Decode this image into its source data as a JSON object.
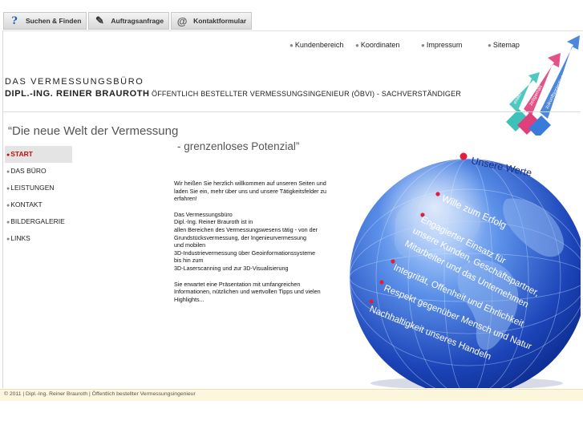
{
  "toolbar": {
    "tabs": [
      {
        "label": "Suchen & Finden",
        "icon": "question-icon"
      },
      {
        "label": "Auftragsanfrage",
        "icon": "pen-icon"
      },
      {
        "label": "Kontaktformular",
        "icon": "mail-icon"
      }
    ]
  },
  "topnav": [
    {
      "label": "Kundenbereich"
    },
    {
      "label": "Koordinaten"
    },
    {
      "label": "Impressum"
    },
    {
      "label": "Sitemap"
    }
  ],
  "header": {
    "line1": "DAS VERMESSUNGSBÜRO",
    "line2": "DIPL.-ING. REINER BRAUROTH",
    "line3": "ÖFFENTLICH BESTELLTER VERMESSUNGSINGENIEUR (ÖBVI)  -  SACHVERSTÄNDIGER",
    "arrow_labels": [
      "exakt",
      "zeitgemäß",
      "zukunftsorientiert"
    ]
  },
  "slogan": {
    "line1": "“Die neue Welt der Vermessung",
    "line2": "- grenzenloses Potenzial”"
  },
  "sidebar": {
    "items": [
      {
        "label": "START",
        "active": true
      },
      {
        "label": "DAS BÜRO",
        "active": false
      },
      {
        "label": "LEISTUNGEN",
        "active": false
      },
      {
        "label": "KONTAKT",
        "active": false
      },
      {
        "label": "BILDERGALERIE",
        "active": false
      },
      {
        "label": "LINKS",
        "active": false
      }
    ]
  },
  "content": {
    "para1": "Wir heißen Sie herzlich willkommen auf unseren Seiten und laden Sie ein, mehr über uns und unsere Tätigkeitsfelder zu erfahren!",
    "para2_lines": [
      "Das Vermessungsbüro",
      "Dipl.-Ing. Reiner Brauroth ist in",
      "allen Bereichen des Vermessungswesens tätig - von der",
      "Grundstücksvermessung, der Ingenieurvermessung",
      "und mobilen",
      "3D-Industrievermessung über Geoinformationssysteme",
      "bis hin zum",
      "3D-Laserscanning und zur 3D-Visualisierung"
    ],
    "para3": "Sie erwartet eine Präsentation mit umfangreichen Informationen, nützlichen und wertvollen Tipps und vielen Highlights..."
  },
  "globe": {
    "title": "Unsere Werte",
    "values": [
      "Wille zum Erfolg",
      "Engagierter Einsatz für",
      "unsere Kunden, Geschäftspartner,",
      "Mitarbeiter und das Unternehmen",
      "Integrität, Offenheit und Ehrlichkeit",
      "Respekt gegenüber Mensch und Natur",
      "Nachhaltigkeit unseres Handeln"
    ]
  },
  "footer": {
    "text": "© 2011 | Dipl.-Ing. Reiner Brauroth | Öffentlich bestellter Vermessungsingenieur"
  },
  "colors": {
    "active": "#c01010",
    "globe_dark": "#0b2a8a",
    "globe_light": "#7fb0ff",
    "bullet_red": "#e0203a",
    "arrow_teal": "#3cc2b8",
    "arrow_pink": "#e0407a",
    "arrow_blue": "#3a7ad8",
    "footer_bg": "#fbf6dc"
  }
}
